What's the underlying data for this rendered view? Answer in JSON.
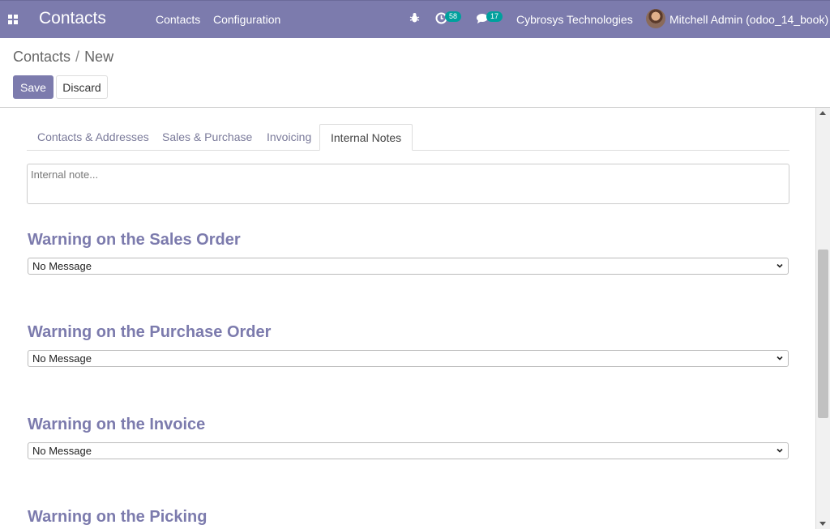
{
  "navbar": {
    "brand": "Contacts",
    "menu": [
      "Contacts",
      "Configuration"
    ],
    "activity_count": "58",
    "message_count": "17",
    "company": "Cybrosys Technologies",
    "user": "Mitchell Admin (odoo_14_book)"
  },
  "breadcrumb": {
    "parent": "Contacts",
    "separator": "/",
    "current": "New"
  },
  "buttons": {
    "save": "Save",
    "discard": "Discard"
  },
  "tabs": [
    "Contacts & Addresses",
    "Sales & Purchase",
    "Invoicing",
    "Internal Notes"
  ],
  "active_tab": "Internal Notes",
  "note": {
    "placeholder": "Internal note..."
  },
  "warnings": [
    {
      "title": "Warning on the Sales Order",
      "value": "No Message"
    },
    {
      "title": "Warning on the Purchase Order",
      "value": "No Message"
    },
    {
      "title": "Warning on the Invoice",
      "value": "No Message"
    },
    {
      "title": "Warning on the Picking"
    }
  ],
  "colors": {
    "primary": "#7c7bad",
    "badge": "#00a09d"
  }
}
